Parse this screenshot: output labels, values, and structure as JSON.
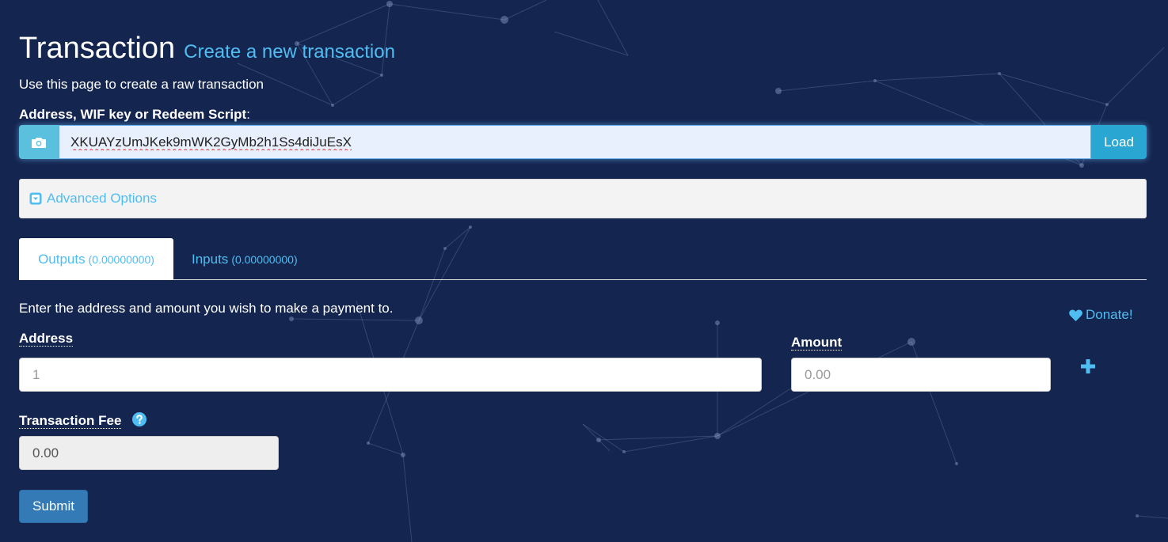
{
  "header": {
    "title": "Transaction",
    "subtitle": "Create a new transaction",
    "lead": "Use this page to create a raw transaction"
  },
  "address_section": {
    "label": "Address, WIF key or Redeem Script",
    "label_suffix": ":",
    "value": "XKUAYzUmJKek9mWK2GyMb2h1Ss4diJuEsX",
    "load_label": "Load",
    "scan_icon": "camera-icon"
  },
  "advanced": {
    "label": "Advanced Options",
    "icon": "caret-square-down-icon"
  },
  "tabs": [
    {
      "label": "Outputs",
      "count": "(0.00000000)",
      "active": true
    },
    {
      "label": "Inputs",
      "count": "(0.00000000)",
      "active": false
    }
  ],
  "outputs": {
    "instructions": "Enter the address and amount you wish to make a payment to.",
    "address_label": "Address",
    "address_placeholder": "1",
    "amount_label": "Amount",
    "amount_placeholder": "0.00",
    "add_icon": "plus-icon"
  },
  "donate": {
    "label": "Donate!",
    "icon": "heart-icon"
  },
  "fee": {
    "label": "Transaction Fee",
    "value": "0.00",
    "help_icon": "question-circle-icon"
  },
  "submit_label": "Submit",
  "colors": {
    "background": "#14254f",
    "accent": "#4fbdf2",
    "info_button": "#5bc0de",
    "load_button": "#2aa6d3",
    "primary_button": "#337ab7"
  }
}
